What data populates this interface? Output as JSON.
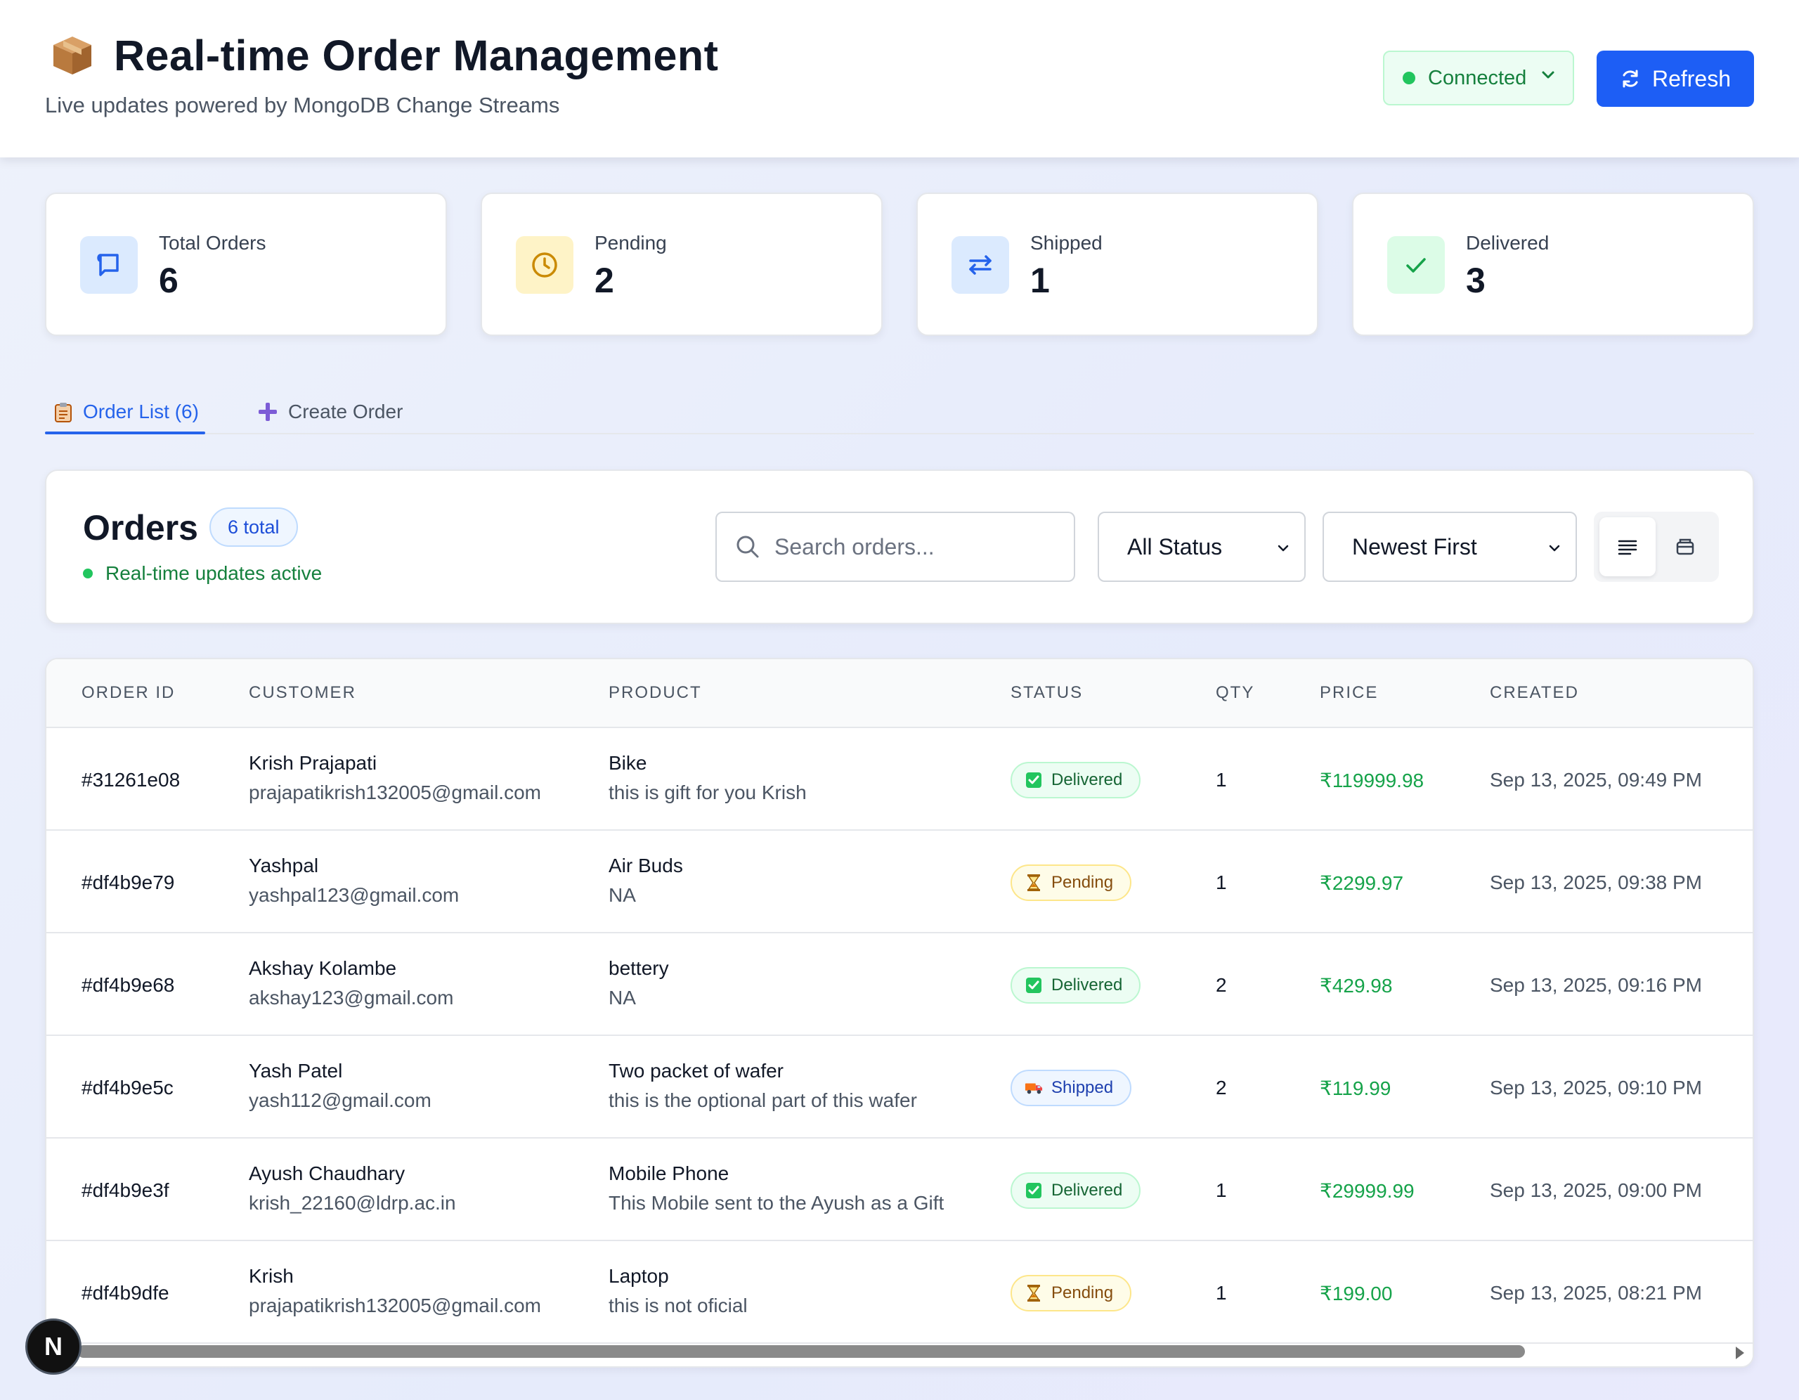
{
  "header": {
    "title": "Real-time Order Management",
    "subtitle": "Live updates powered by MongoDB Change Streams",
    "connection_label": "Connected",
    "refresh_label": "Refresh",
    "logo_icon": "package-box-icon"
  },
  "stats": [
    {
      "label": "Total Orders",
      "value": "6",
      "icon": "order-list-icon",
      "color": "#2563eb"
    },
    {
      "label": "Pending",
      "value": "2",
      "icon": "clock-icon",
      "color": "#ca8a04"
    },
    {
      "label": "Shipped",
      "value": "1",
      "icon": "swap-arrows-icon",
      "color": "#2563eb"
    },
    {
      "label": "Delivered",
      "value": "3",
      "icon": "check-icon",
      "color": "#16a34a"
    }
  ],
  "tabs": [
    {
      "label": "Order List (6)",
      "icon": "clipboard-icon",
      "active": true
    },
    {
      "label": "Create Order",
      "icon": "plus-icon",
      "active": false
    }
  ],
  "orders_panel": {
    "title": "Orders",
    "total_badge": "6 total",
    "realtime_label": "Real-time updates active",
    "search_placeholder": "Search orders...",
    "status_filter": "All Status",
    "sort_order": "Newest First"
  },
  "table": {
    "columns": [
      "ORDER ID",
      "CUSTOMER",
      "PRODUCT",
      "STATUS",
      "QTY",
      "PRICE",
      "CREATED"
    ],
    "rows": [
      {
        "id": "#31261e08",
        "name": "Krish Prajapati",
        "email": "prajapatikrish132005@gmail.com",
        "product": "Bike",
        "desc": "this is gift for you Krish",
        "status": "Delivered",
        "qty": "1",
        "price": "₹119999.98",
        "created": "Sep 13, 2025, 09:49 PM"
      },
      {
        "id": "#df4b9e79",
        "name": "Yashpal",
        "email": "yashpal123@gmail.com",
        "product": "Air Buds",
        "desc": "NA",
        "status": "Pending",
        "qty": "1",
        "price": "₹2299.97",
        "created": "Sep 13, 2025, 09:38 PM"
      },
      {
        "id": "#df4b9e68",
        "name": "Akshay Kolambe",
        "email": "akshay123@gmail.com",
        "product": "bettery",
        "desc": "NA",
        "status": "Delivered",
        "qty": "2",
        "price": "₹429.98",
        "created": "Sep 13, 2025, 09:16 PM"
      },
      {
        "id": "#df4b9e5c",
        "name": "Yash Patel",
        "email": "yash112@gmail.com",
        "product": "Two packet of wafer",
        "desc": "this is the optional part of this wafer",
        "status": "Shipped",
        "qty": "2",
        "price": "₹119.99",
        "created": "Sep 13, 2025, 09:10 PM"
      },
      {
        "id": "#df4b9e3f",
        "name": "Ayush Chaudhary",
        "email": "krish_22160@ldrp.ac.in",
        "product": "Mobile Phone",
        "desc": "This Mobile sent to the Ayush as a Gift",
        "status": "Delivered",
        "qty": "1",
        "price": "₹29999.99",
        "created": "Sep 13, 2025, 09:00 PM"
      },
      {
        "id": "#df4b9dfe",
        "name": "Krish",
        "email": "prajapatikrish132005@gmail.com",
        "product": "Laptop",
        "desc": "this is not oficial",
        "status": "Pending",
        "qty": "1",
        "price": "₹199.00",
        "created": "Sep 13, 2025, 08:21 PM"
      }
    ]
  },
  "dev_badge": "N",
  "colors": {
    "accent": "#1d5ef5",
    "success": "#16a34a",
    "warning": "#ca8a04"
  }
}
